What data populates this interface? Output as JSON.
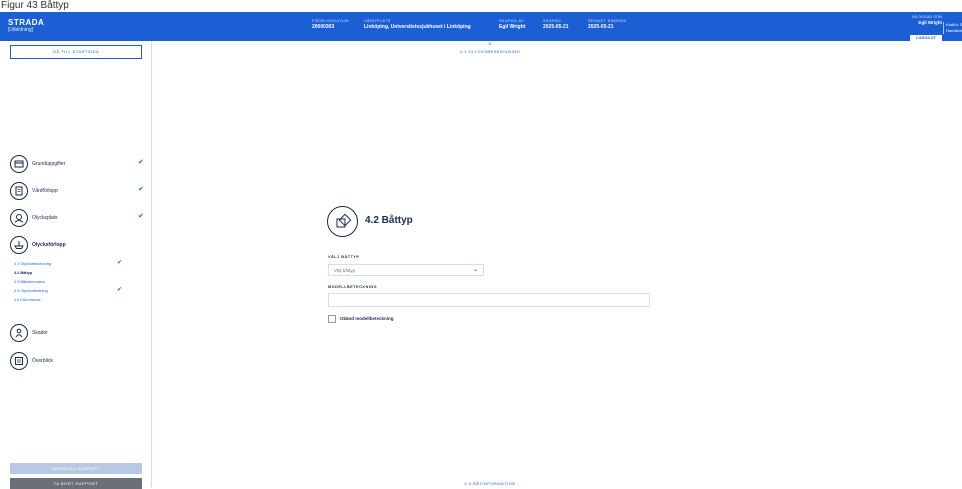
{
  "caption": "Figur 43 Båttyp",
  "brand": {
    "name": "STRADA",
    "subtitle": "[Utbildning]"
  },
  "header": {
    "fields": [
      {
        "label": "FÖDELSEDATUM",
        "value": "20000303"
      },
      {
        "label": "VÅRDPLATS",
        "value": "Linköping, Universitetssjukhuset i Linköping"
      },
      {
        "label": "SKAPAD AV",
        "value": "Egil Wright"
      },
      {
        "label": "SKAPAD",
        "value": "2025-05-21"
      },
      {
        "label": "SENAST ÄNDRAD",
        "value": "2025-05-21"
      }
    ],
    "login_label": "INLOGGAD SOM",
    "login_user": "Egil Wright",
    "logout_label": "LOGGA UT",
    "right_info": [
      "Kod/Id: STR",
      "Handledning"
    ]
  },
  "sidebar": {
    "start_label": "GÅ TILL STARTSIDA",
    "items": [
      {
        "label": "Grunduppgifter",
        "icon": "card-icon",
        "checked": true
      },
      {
        "label": "Vårdförlopp",
        "icon": "document-icon",
        "checked": true
      },
      {
        "label": "Olycksplats",
        "icon": "map-icon",
        "checked": true
      },
      {
        "label": "Olycksförlopp",
        "icon": "boat-icon",
        "checked": false
      },
      {
        "label": "Skador",
        "icon": "person-icon",
        "checked": false
      },
      {
        "label": "Överblick",
        "icon": "overview-icon",
        "checked": false
      }
    ],
    "subitems": [
      {
        "label": "4.1 Olycksbeskrivning",
        "checked": true,
        "active": false
      },
      {
        "label": "4.2 Båttyp",
        "checked": false,
        "active": true
      },
      {
        "label": "4.3 Båtinformation",
        "checked": false,
        "active": false
      },
      {
        "label": "4.4 Olycksutredning",
        "checked": true,
        "active": false
      },
      {
        "label": "4.5 Fall ombord",
        "checked": false,
        "active": false
      }
    ],
    "save_label": "ARKIVERA RAPPORT",
    "remove_label": "TA BORT RAPPORT"
  },
  "main": {
    "prev_label": "4.1 OLYCKSBESKRIVNING",
    "section_title": "4.2 Båttyp",
    "select_label": "VÄLJ BÅTTYP",
    "select_placeholder": "Välj båttyp",
    "model_label": "MODELLBETECKNING",
    "model_value": "",
    "unknown_label": "Okänd modellbeteckning",
    "next_label": "4.3 BÅTINFORMATION"
  },
  "colors": {
    "primary": "#1c5fd4",
    "text": "#1a2a4a",
    "disabled": "#b8c9e6",
    "danger": "#6b6f78"
  }
}
